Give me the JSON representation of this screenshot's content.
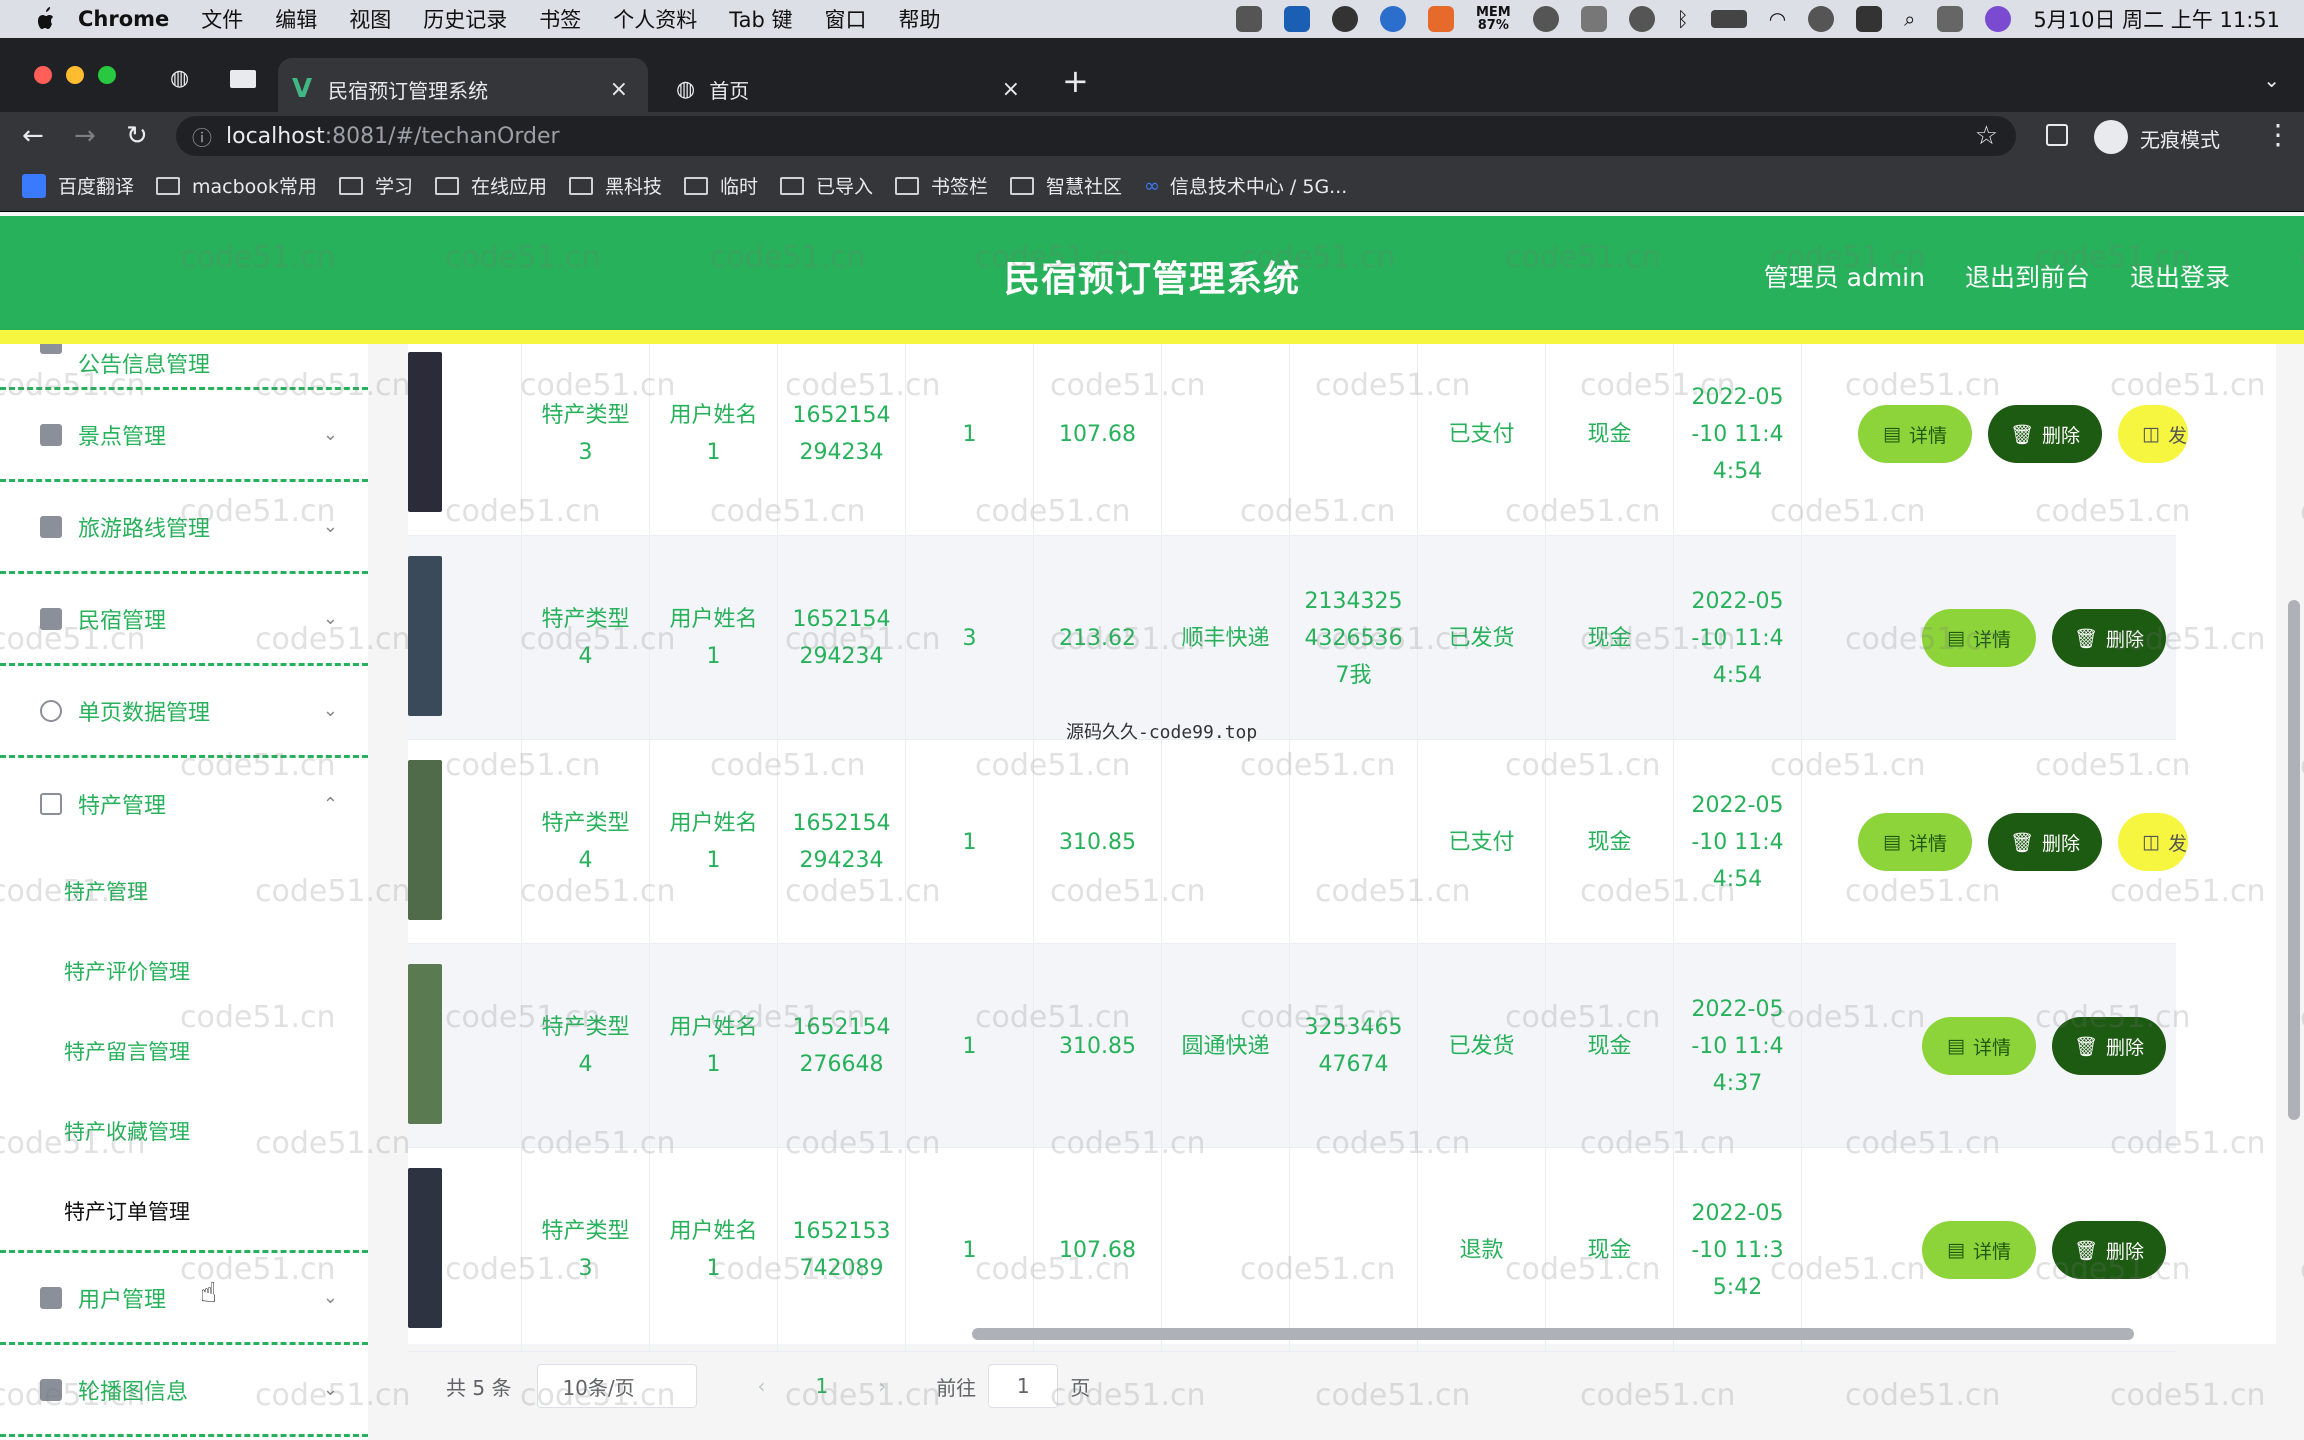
{
  "macos_menubar": {
    "app": "Chrome",
    "menus": [
      "文件",
      "编辑",
      "视图",
      "历史记录",
      "书签",
      "个人资料",
      "Tab 键",
      "窗口",
      "帮助"
    ],
    "mem_label": "MEM",
    "mem_value": "87%",
    "clock": "5月10日 周二 上午 11:51"
  },
  "browser": {
    "tabs": [
      {
        "title": "民宿预订管理系统",
        "active": true
      },
      {
        "title": "首页",
        "active": false
      }
    ],
    "url_host": "localhost",
    "url_rest": ":8081/#/techanOrder",
    "incognito_label": "无痕模式",
    "bookmarks": [
      "百度翻译",
      "macbook常用",
      "学习",
      "在线应用",
      "黑科技",
      "临时",
      "已导入",
      "书签栏",
      "智慧社区",
      "信息技术中心 / 5G..."
    ]
  },
  "header": {
    "title": "民宿预订管理系统",
    "admin": "管理员 admin",
    "to_front": "退出到前台",
    "logout": "退出登录"
  },
  "sidebar": {
    "top_partial": "公告信息管理",
    "menus": [
      {
        "label": "景点管理",
        "icon": "user-icon"
      },
      {
        "label": "旅游路线管理",
        "icon": "chart-icon"
      },
      {
        "label": "民宿管理",
        "icon": "chat-icon"
      },
      {
        "label": "单页数据管理",
        "icon": "compass-icon"
      },
      {
        "label": "特产管理",
        "icon": "copy-icon"
      },
      {
        "label": "用户管理",
        "icon": "monitor-icon"
      },
      {
        "label": "轮播图信息",
        "icon": "send-icon"
      }
    ],
    "submenu": [
      "特产管理",
      "特产评价管理",
      "特产留言管理",
      "特产收藏管理",
      "特产订单管理"
    ],
    "current": "特产订单管理"
  },
  "table": {
    "rows": [
      {
        "type": "特产类型\n3",
        "user": "用户姓名\n1",
        "phone": "1652154\n294234",
        "qty": "1",
        "price": "107.68",
        "courier": "",
        "tracking": "",
        "status": "已支付",
        "pay": "现金",
        "time": "2022-05\n-10 11:4\n4:54",
        "ship_btn": true
      },
      {
        "type": "特产类型\n4",
        "user": "用户姓名\n1",
        "phone": "1652154\n294234",
        "qty": "3",
        "price": "213.62",
        "courier": "顺丰快递",
        "tracking": "2134325\n4326536\n7我",
        "status": "已发货",
        "pay": "现金",
        "time": "2022-05\n-10 11:4\n4:54",
        "ship_btn": false
      },
      {
        "type": "特产类型\n4",
        "user": "用户姓名\n1",
        "phone": "1652154\n294234",
        "qty": "1",
        "price": "310.85",
        "courier": "",
        "tracking": "",
        "status": "已支付",
        "pay": "现金",
        "time": "2022-05\n-10 11:4\n4:54",
        "ship_btn": true
      },
      {
        "type": "特产类型\n4",
        "user": "用户姓名\n1",
        "phone": "1652154\n276648",
        "qty": "1",
        "price": "310.85",
        "courier": "圆通快递",
        "tracking": "3253465\n47674",
        "status": "已发货",
        "pay": "现金",
        "time": "2022-05\n-10 11:4\n4:37",
        "ship_btn": false
      },
      {
        "type": "特产类型\n3",
        "user": "用户姓名\n1",
        "phone": "1652153\n742089",
        "qty": "1",
        "price": "107.68",
        "courier": "",
        "tracking": "",
        "status": "退款",
        "pay": "现金",
        "time": "2022-05\n-10 11:3\n5:42",
        "ship_btn": false
      }
    ],
    "detail_label": "详情",
    "delete_label": "删除",
    "ship_label": "发"
  },
  "pagination": {
    "total": "共 5 条",
    "page_size": "10条/页",
    "current": "1",
    "goto_label": "前往",
    "goto_value": "1",
    "page_suffix": "页"
  },
  "overlay_note": "源码久久-code99.top",
  "watermark": "code51.cn",
  "colors": {
    "primary": "#27b15a",
    "accent_yellow": "#f6f640",
    "detail_btn": "#8dd33a",
    "delete_btn": "#1d5a12"
  }
}
